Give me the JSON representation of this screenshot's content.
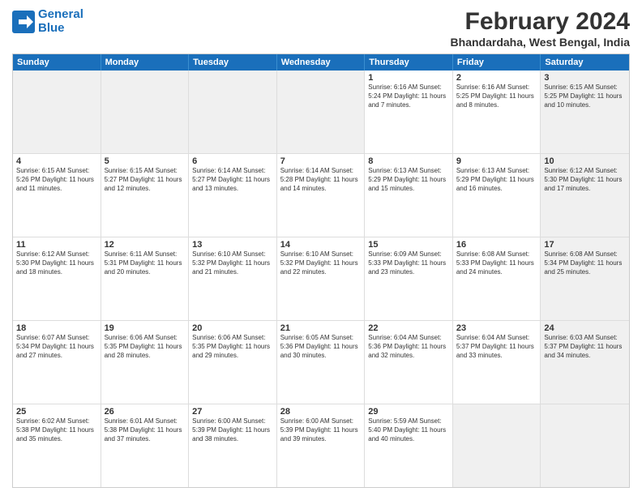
{
  "logo": {
    "line1": "General",
    "line2": "Blue"
  },
  "title": "February 2024",
  "subtitle": "Bhandardaha, West Bengal, India",
  "header_days": [
    "Sunday",
    "Monday",
    "Tuesday",
    "Wednesday",
    "Thursday",
    "Friday",
    "Saturday"
  ],
  "rows": [
    [
      {
        "day": "",
        "info": "",
        "shaded": true
      },
      {
        "day": "",
        "info": "",
        "shaded": true
      },
      {
        "day": "",
        "info": "",
        "shaded": true
      },
      {
        "day": "",
        "info": "",
        "shaded": true
      },
      {
        "day": "1",
        "info": "Sunrise: 6:16 AM\nSunset: 5:24 PM\nDaylight: 11 hours and 7 minutes.",
        "shaded": false
      },
      {
        "day": "2",
        "info": "Sunrise: 6:16 AM\nSunset: 5:25 PM\nDaylight: 11 hours and 8 minutes.",
        "shaded": false
      },
      {
        "day": "3",
        "info": "Sunrise: 6:15 AM\nSunset: 5:25 PM\nDaylight: 11 hours and 10 minutes.",
        "shaded": true
      }
    ],
    [
      {
        "day": "4",
        "info": "Sunrise: 6:15 AM\nSunset: 5:26 PM\nDaylight: 11 hours and 11 minutes.",
        "shaded": false
      },
      {
        "day": "5",
        "info": "Sunrise: 6:15 AM\nSunset: 5:27 PM\nDaylight: 11 hours and 12 minutes.",
        "shaded": false
      },
      {
        "day": "6",
        "info": "Sunrise: 6:14 AM\nSunset: 5:27 PM\nDaylight: 11 hours and 13 minutes.",
        "shaded": false
      },
      {
        "day": "7",
        "info": "Sunrise: 6:14 AM\nSunset: 5:28 PM\nDaylight: 11 hours and 14 minutes.",
        "shaded": false
      },
      {
        "day": "8",
        "info": "Sunrise: 6:13 AM\nSunset: 5:29 PM\nDaylight: 11 hours and 15 minutes.",
        "shaded": false
      },
      {
        "day": "9",
        "info": "Sunrise: 6:13 AM\nSunset: 5:29 PM\nDaylight: 11 hours and 16 minutes.",
        "shaded": false
      },
      {
        "day": "10",
        "info": "Sunrise: 6:12 AM\nSunset: 5:30 PM\nDaylight: 11 hours and 17 minutes.",
        "shaded": true
      }
    ],
    [
      {
        "day": "11",
        "info": "Sunrise: 6:12 AM\nSunset: 5:30 PM\nDaylight: 11 hours and 18 minutes.",
        "shaded": false
      },
      {
        "day": "12",
        "info": "Sunrise: 6:11 AM\nSunset: 5:31 PM\nDaylight: 11 hours and 20 minutes.",
        "shaded": false
      },
      {
        "day": "13",
        "info": "Sunrise: 6:10 AM\nSunset: 5:32 PM\nDaylight: 11 hours and 21 minutes.",
        "shaded": false
      },
      {
        "day": "14",
        "info": "Sunrise: 6:10 AM\nSunset: 5:32 PM\nDaylight: 11 hours and 22 minutes.",
        "shaded": false
      },
      {
        "day": "15",
        "info": "Sunrise: 6:09 AM\nSunset: 5:33 PM\nDaylight: 11 hours and 23 minutes.",
        "shaded": false
      },
      {
        "day": "16",
        "info": "Sunrise: 6:08 AM\nSunset: 5:33 PM\nDaylight: 11 hours and 24 minutes.",
        "shaded": false
      },
      {
        "day": "17",
        "info": "Sunrise: 6:08 AM\nSunset: 5:34 PM\nDaylight: 11 hours and 25 minutes.",
        "shaded": true
      }
    ],
    [
      {
        "day": "18",
        "info": "Sunrise: 6:07 AM\nSunset: 5:34 PM\nDaylight: 11 hours and 27 minutes.",
        "shaded": false
      },
      {
        "day": "19",
        "info": "Sunrise: 6:06 AM\nSunset: 5:35 PM\nDaylight: 11 hours and 28 minutes.",
        "shaded": false
      },
      {
        "day": "20",
        "info": "Sunrise: 6:06 AM\nSunset: 5:35 PM\nDaylight: 11 hours and 29 minutes.",
        "shaded": false
      },
      {
        "day": "21",
        "info": "Sunrise: 6:05 AM\nSunset: 5:36 PM\nDaylight: 11 hours and 30 minutes.",
        "shaded": false
      },
      {
        "day": "22",
        "info": "Sunrise: 6:04 AM\nSunset: 5:36 PM\nDaylight: 11 hours and 32 minutes.",
        "shaded": false
      },
      {
        "day": "23",
        "info": "Sunrise: 6:04 AM\nSunset: 5:37 PM\nDaylight: 11 hours and 33 minutes.",
        "shaded": false
      },
      {
        "day": "24",
        "info": "Sunrise: 6:03 AM\nSunset: 5:37 PM\nDaylight: 11 hours and 34 minutes.",
        "shaded": true
      }
    ],
    [
      {
        "day": "25",
        "info": "Sunrise: 6:02 AM\nSunset: 5:38 PM\nDaylight: 11 hours and 35 minutes.",
        "shaded": false
      },
      {
        "day": "26",
        "info": "Sunrise: 6:01 AM\nSunset: 5:38 PM\nDaylight: 11 hours and 37 minutes.",
        "shaded": false
      },
      {
        "day": "27",
        "info": "Sunrise: 6:00 AM\nSunset: 5:39 PM\nDaylight: 11 hours and 38 minutes.",
        "shaded": false
      },
      {
        "day": "28",
        "info": "Sunrise: 6:00 AM\nSunset: 5:39 PM\nDaylight: 11 hours and 39 minutes.",
        "shaded": false
      },
      {
        "day": "29",
        "info": "Sunrise: 5:59 AM\nSunset: 5:40 PM\nDaylight: 11 hours and 40 minutes.",
        "shaded": false
      },
      {
        "day": "",
        "info": "",
        "shaded": true
      },
      {
        "day": "",
        "info": "",
        "shaded": true
      }
    ]
  ]
}
